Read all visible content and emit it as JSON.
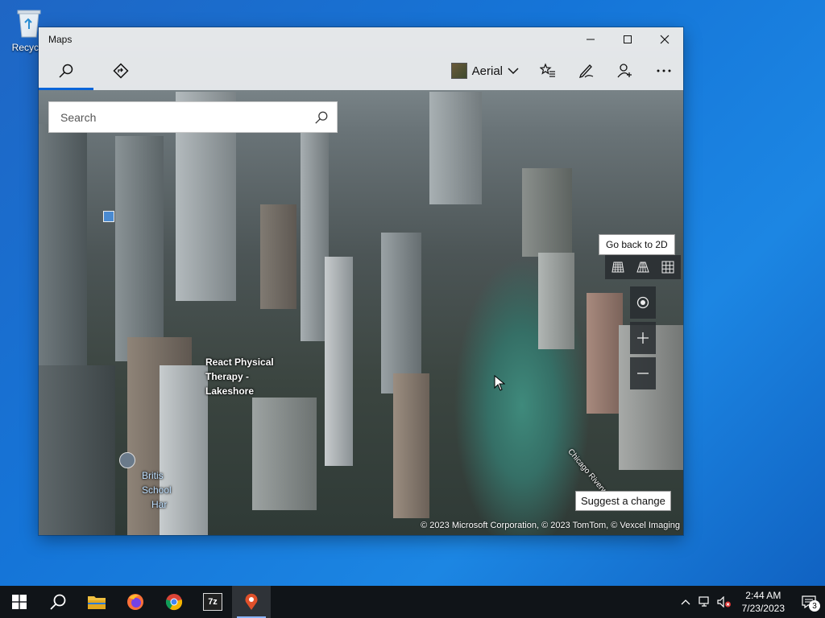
{
  "desktop": {
    "recycle_bin_label": "Recycle"
  },
  "window": {
    "title": "Maps",
    "controls": {
      "minimize": "—",
      "maximize": "☐",
      "close": "✕"
    }
  },
  "toolbar": {
    "map_style_label": "Aerial"
  },
  "search": {
    "placeholder": "Search",
    "value": ""
  },
  "map": {
    "poi_labels": [
      "React Physical",
      "Therapy -",
      "Lakeshore"
    ],
    "partial_labels": [
      "Britis",
      "School",
      "Har"
    ],
    "tooltip": "Go back to 2D",
    "suggest_label": "Suggest a change",
    "copyright": "© 2023 Microsoft Corporation, © 2023 TomTom, © Vexcel Imaging",
    "river_label": "Chicago Riverwalk"
  },
  "taskbar": {
    "clock_time": "2:44 AM",
    "clock_date": "7/23/2023",
    "notification_count": "3",
    "sevenzip_label": "7z"
  },
  "colors": {
    "accent": "#0a64d8",
    "taskbar": "#101418",
    "desktop": "#1575d8"
  }
}
